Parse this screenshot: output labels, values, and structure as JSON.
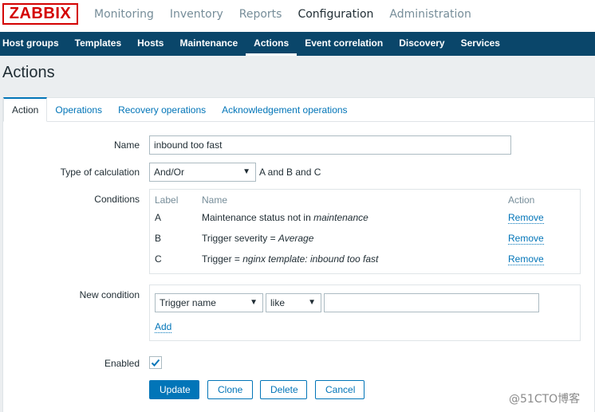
{
  "logo": "ZABBIX",
  "main_menu": [
    {
      "label": "Monitoring",
      "active": false
    },
    {
      "label": "Inventory",
      "active": false
    },
    {
      "label": "Reports",
      "active": false
    },
    {
      "label": "Configuration",
      "active": true
    },
    {
      "label": "Administration",
      "active": false
    }
  ],
  "sub_menu": [
    {
      "label": "Host groups",
      "active": false
    },
    {
      "label": "Templates",
      "active": false
    },
    {
      "label": "Hosts",
      "active": false
    },
    {
      "label": "Maintenance",
      "active": false
    },
    {
      "label": "Actions",
      "active": true
    },
    {
      "label": "Event correlation",
      "active": false
    },
    {
      "label": "Discovery",
      "active": false
    },
    {
      "label": "Services",
      "active": false
    }
  ],
  "page_title": "Actions",
  "tabs": [
    {
      "label": "Action",
      "active": true
    },
    {
      "label": "Operations",
      "active": false
    },
    {
      "label": "Recovery operations",
      "active": false
    },
    {
      "label": "Acknowledgement operations",
      "active": false
    }
  ],
  "form": {
    "name_label": "Name",
    "name_value": "inbound too fast",
    "calc_label": "Type of calculation",
    "calc_value": "And/Or",
    "calc_formula": "A and B and C",
    "conditions_label": "Conditions",
    "conditions_headers": {
      "label": "Label",
      "name": "Name",
      "action": "Action"
    },
    "conditions": [
      {
        "label": "A",
        "name_prefix": "Maintenance status not in ",
        "name_value": "maintenance",
        "action": "Remove"
      },
      {
        "label": "B",
        "name_prefix": "Trigger severity = ",
        "name_value": "Average",
        "action": "Remove"
      },
      {
        "label": "C",
        "name_prefix": "Trigger = ",
        "name_value": "nginx template: inbound too fast",
        "action": "Remove"
      }
    ],
    "new_condition_label": "New condition",
    "new_condition_type": "Trigger name",
    "new_condition_operator": "like",
    "new_condition_value": "",
    "add_label": "Add",
    "enabled_label": "Enabled",
    "enabled": true
  },
  "buttons": {
    "update": "Update",
    "clone": "Clone",
    "delete": "Delete",
    "cancel": "Cancel"
  },
  "watermark": "@51CTO博客",
  "colors": {
    "brand_red": "#d40000",
    "nav_blue": "#0a466a",
    "link_blue": "#0275b8"
  }
}
